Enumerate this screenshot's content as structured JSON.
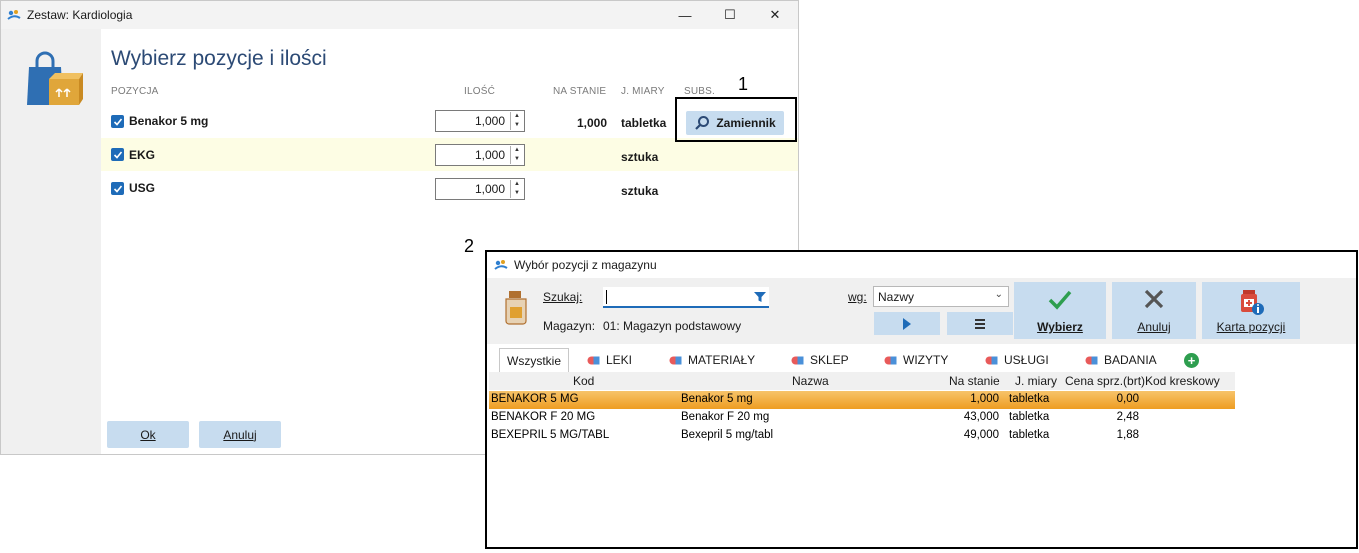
{
  "window1": {
    "title": "Zestaw: Kardiologia",
    "heading": "Wybierz pozycje i ilości",
    "columns": {
      "pozycja": "POZYCJA",
      "ilosc": "ILOŚĆ",
      "na_stanie": "NA STANIE",
      "jm": "J. MIARY",
      "subs": "SUBS."
    },
    "rows": [
      {
        "name": "Benakor 5 mg",
        "checked": true,
        "qty": "1,000",
        "stock": "1,000",
        "unit": "tabletka",
        "highlighted": false
      },
      {
        "name": "EKG",
        "checked": true,
        "qty": "1,000",
        "stock": "",
        "unit": "sztuka",
        "highlighted": true
      },
      {
        "name": "USG",
        "checked": true,
        "qty": "1,000",
        "stock": "",
        "unit": "sztuka",
        "highlighted": false
      }
    ],
    "substitute_button": "Zamiennik",
    "ok_button": "Ok",
    "cancel_button": "Anuluj",
    "caption_minimize": "—",
    "caption_maximize": "☐",
    "caption_close": "✕"
  },
  "annotations": {
    "label_1": "1",
    "label_2": "2"
  },
  "window2": {
    "title": "Wybór pozycji z magazynu",
    "search_label": "Szukaj:",
    "search_value": "",
    "warehouse_label": "Magazyn:",
    "warehouse_value": "01: Magazyn podstawowy",
    "sort_label": "wg:",
    "sort_value": "Nazwy",
    "select_button": "Wybierz",
    "cancel_button": "Anuluj",
    "card_button": "Karta pozycji",
    "tabs": [
      "Wszystkie",
      "LEKI",
      "MATERIAŁY",
      "SKLEP",
      "WIZYTY",
      "USŁUGI",
      "BADANIA"
    ],
    "active_tab": "Wszystkie",
    "grid_columns": {
      "kod": "Kod",
      "nazwa": "Nazwa",
      "na_stanie": "Na stanie",
      "jm": "J. miary",
      "cena": "Cena sprz.(brt)",
      "kod_kreskowy": "Kod kreskowy"
    },
    "grid_rows": [
      {
        "kod": "BENAKOR 5 MG",
        "nazwa": "Benakor 5 mg",
        "na_stanie": "1,000",
        "jm": "tabletka",
        "cena": "0,00",
        "kod_kreskowy": "",
        "selected": true
      },
      {
        "kod": "BENAKOR F 20 MG",
        "nazwa": "Benakor F 20 mg",
        "na_stanie": "43,000",
        "jm": "tabletka",
        "cena": "2,48",
        "kod_kreskowy": "",
        "selected": false
      },
      {
        "kod": "BEXEPRIL 5 MG/TABL",
        "nazwa": "Bexepril 5 mg/tabl",
        "na_stanie": "49,000",
        "jm": "tabletka",
        "cena": "1,88",
        "kod_kreskowy": "",
        "selected": false
      }
    ]
  },
  "colors": {
    "accent": "#1e6bb8",
    "button_bg": "#c7dcef",
    "highlight_row": "#fdfde4",
    "selected_row": "#ee9d22",
    "heading": "#2c4a75"
  }
}
